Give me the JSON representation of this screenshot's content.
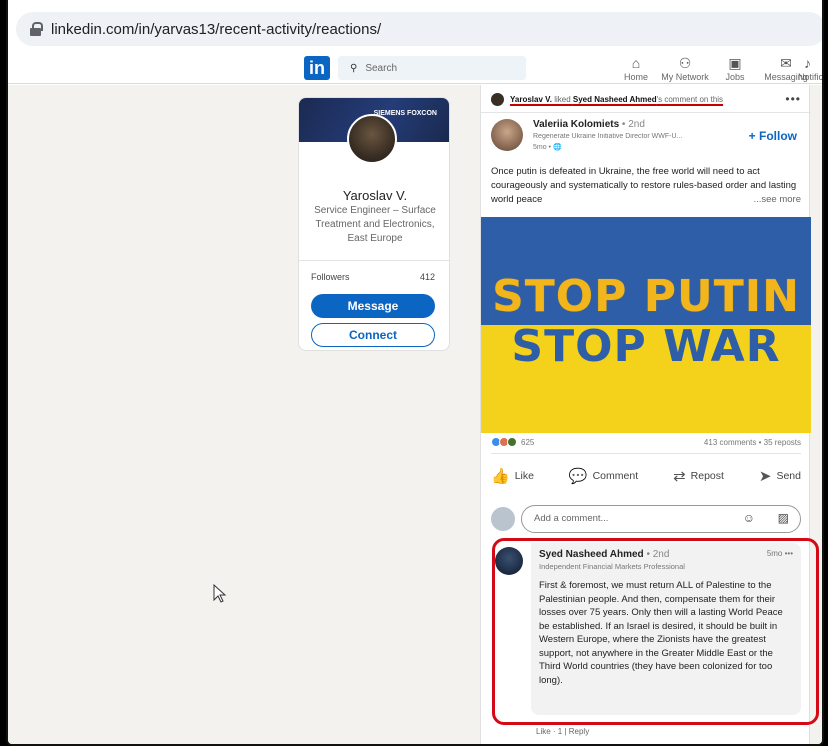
{
  "browser": {
    "url": "linkedin.com/in/yarvas13/recent-activity/reactions/"
  },
  "header": {
    "logo": "in",
    "search_placeholder": "Search",
    "nav": [
      {
        "label": "Home",
        "icon": "home-icon"
      },
      {
        "label": "My Network",
        "icon": "network-icon"
      },
      {
        "label": "Jobs",
        "icon": "jobs-icon"
      },
      {
        "label": "Messaging",
        "icon": "messaging-icon"
      },
      {
        "label": "Notific",
        "icon": "bell-icon"
      }
    ]
  },
  "profile": {
    "banner_brand": "SIEMENS FOXCON",
    "name": "Yaroslav V.",
    "headline": "Service Engineer – Surface Treatment and Electronics, East Europe",
    "followers_label": "Followers",
    "followers_count": "412",
    "message_label": "Message",
    "connect_label": "Connect"
  },
  "post": {
    "activity_actor": "Yaroslav V.",
    "activity_mid": " liked ",
    "activity_target": "Syed Nasheed Ahmed",
    "activity_tail": "'s comment on this",
    "author_name": "Valeriia Kolomiets",
    "author_degree": " • 2nd",
    "author_headline": "Regenerate Ukraine Initiative Director WWF-U...",
    "author_time": "5mo • ",
    "follow_label": "+ Follow",
    "text": "Once putin is defeated in Ukraine, the free world will need to act courageously and systematically to restore rules-based order and lasting world peace",
    "see_more": "...see more",
    "poster_line1": "STOP PUTIN",
    "poster_line2": "STOP WAR",
    "reaction_count": "625",
    "comments_reposts": "413 comments • 35 reposts",
    "actions": {
      "like": "Like",
      "comment": "Comment",
      "repost": "Repost",
      "send": "Send"
    },
    "comment_placeholder": "Add a comment..."
  },
  "comment": {
    "name": "Syed Nasheed Ahmed",
    "degree": " • 2nd",
    "headline": "Independent Financial Markets Professional",
    "time": "5mo •••",
    "body": "First & foremost, we must return ALL of Palestine to the Palestinian people. And then, compensate them for their losses over 75 years. Only then will a lasting World Peace be established. If an Israel is desired, it should be built in Western Europe, where the Zionists have the greatest support, not anywhere in the Greater Middle East or the Third World countries (they have been colonized for too long).",
    "footer": "Like · 1 | Reply"
  },
  "colors": {
    "linkedin_blue": "#0a66c2",
    "highlight_red": "#d30a16",
    "ukraine_blue": "#2f5ea8",
    "ukraine_yellow": "#f4d21c"
  }
}
